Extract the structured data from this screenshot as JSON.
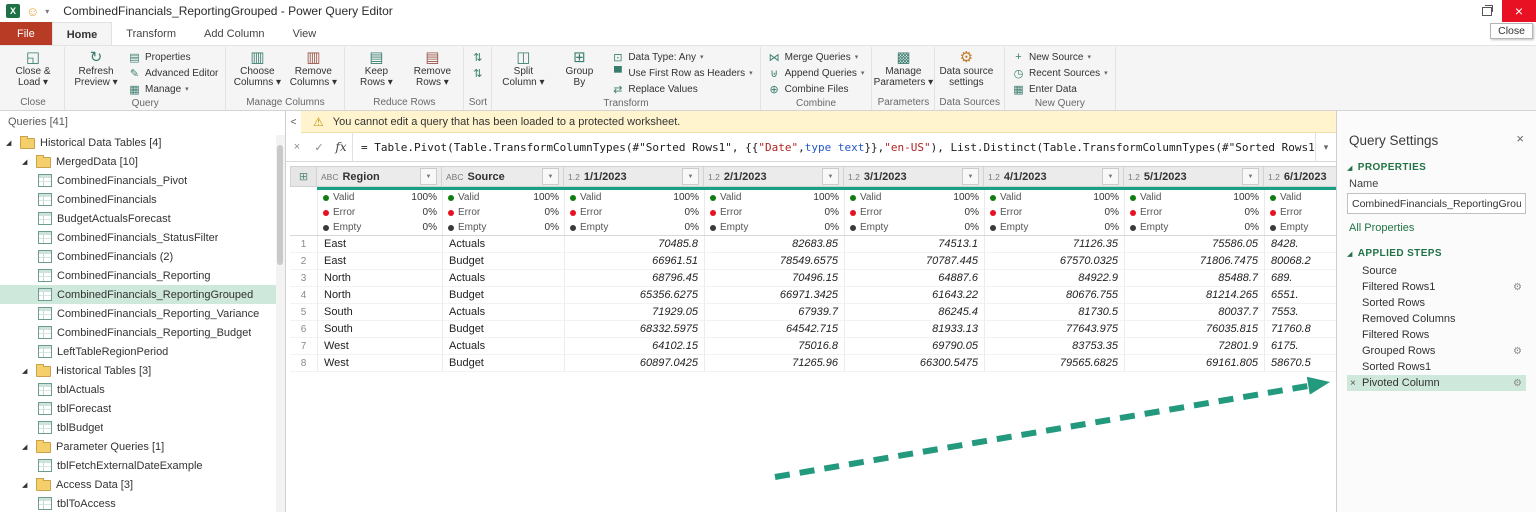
{
  "colors": {
    "accent_teal": "#18a084",
    "arrow_teal": "#23997d",
    "valid_green": "#107c10",
    "error_red": "#e81123",
    "empty_dark": "#3a3a38",
    "selected_green": "#cfe8dc",
    "file_tab_red": "#b83b26",
    "warning_bg": "#fff4ce",
    "section_green": "#217346"
  },
  "icons": {
    "excel-app": "X",
    "feedback-smiley": "☺",
    "qat-caret": "▾",
    "close-and-load": "◱",
    "refresh-preview": "↻",
    "properties": "▤",
    "advanced-editor": "✎",
    "manage-query": "▦",
    "choose-columns": "▥",
    "remove-columns": "▥",
    "keep-rows": "▤",
    "remove-rows": "▤",
    "sort-ascending": "⇅",
    "sort-descending": "⇅",
    "split-column": "◫",
    "group-by": "⊞",
    "data-type": "⊡",
    "use-first-row-as-headers": "▀",
    "replace-values": "⇄",
    "merge-queries": "⋈",
    "append-queries": "⊎",
    "combine-files": "⊕",
    "manage-parameters": "▩",
    "data-source-settings": "⚙",
    "new-source": "+",
    "recent-sources": "◷",
    "enter-data": "▦",
    "warning": "⚠",
    "corner": "⊞",
    "filter": "▼",
    "gear": "⚙",
    "delete": "×",
    "expander": "◢",
    "chevron-down": "▾",
    "collapse-left": "<",
    "cancel": "×",
    "check": "✓",
    "restore": "",
    "close": "×"
  },
  "titlebar": {
    "title": "CombinedFinancials_ReportingGrouped - Power Query Editor",
    "close_tooltip": "Close"
  },
  "ribbon": {
    "tabs": [
      {
        "label": "File",
        "style": "file"
      },
      {
        "label": "Home",
        "active": true
      },
      {
        "label": "Transform"
      },
      {
        "label": "Add Column"
      },
      {
        "label": "View"
      }
    ],
    "groups": [
      {
        "caption": "Close",
        "items": [
          {
            "kind": "big",
            "lines": [
              "Close &",
              "Load"
            ],
            "arrow": true,
            "icon": "close-and-load"
          }
        ]
      },
      {
        "caption": "Query",
        "items": [
          {
            "kind": "big",
            "lines": [
              "Refresh",
              "Preview"
            ],
            "arrow": true,
            "icon": "refresh-preview"
          },
          {
            "kind": "col",
            "buttons": [
              {
                "label": "Properties",
                "icon": "properties"
              },
              {
                "label": "Advanced Editor",
                "icon": "advanced-editor"
              },
              {
                "label": "Manage",
                "arrow": true,
                "icon": "manage-query"
              }
            ]
          }
        ]
      },
      {
        "caption": "Manage Columns",
        "items": [
          {
            "kind": "big",
            "lines": [
              "Choose",
              "Columns"
            ],
            "arrow": true,
            "icon": "choose-columns"
          },
          {
            "kind": "big",
            "lines": [
              "Remove",
              "Columns"
            ],
            "arrow": true,
            "icon": "remove-columns"
          }
        ]
      },
      {
        "caption": "Reduce Rows",
        "items": [
          {
            "kind": "big",
            "lines": [
              "Keep",
              "Rows"
            ],
            "arrow": true,
            "icon": "keep-rows"
          },
          {
            "kind": "big",
            "lines": [
              "Remove",
              "Rows"
            ],
            "arrow": true,
            "icon": "remove-rows"
          }
        ]
      },
      {
        "caption": "Sort",
        "items": [
          {
            "kind": "col",
            "buttons": [
              {
                "label": "",
                "icon": "sort-ascending"
              },
              {
                "label": "",
                "icon": "sort-descending"
              }
            ]
          }
        ]
      },
      {
        "caption": "Transform",
        "items": [
          {
            "kind": "big",
            "lines": [
              "Split",
              "Column"
            ],
            "arrow": true,
            "icon": "split-column"
          },
          {
            "kind": "big",
            "lines": [
              "Group",
              "By"
            ],
            "icon": "group-by"
          },
          {
            "kind": "col",
            "buttons": [
              {
                "label": "Data Type: Any",
                "arrow": true,
                "icon": "data-type"
              },
              {
                "label": "Use First Row as Headers",
                "arrow": true,
                "icon": "use-first-row-as-headers"
              },
              {
                "label": "Replace Values",
                "icon": "replace-values"
              }
            ]
          }
        ]
      },
      {
        "caption": "Combine",
        "items": [
          {
            "kind": "col",
            "buttons": [
              {
                "label": "Merge Queries",
                "arrow": true,
                "icon": "merge-queries"
              },
              {
                "label": "Append Queries",
                "arrow": true,
                "icon": "append-queries"
              },
              {
                "label": "Combine Files",
                "icon": "combine-files"
              }
            ]
          }
        ]
      },
      {
        "caption": "Parameters",
        "items": [
          {
            "kind": "big",
            "lines": [
              "Manage",
              "Parameters"
            ],
            "arrow": true,
            "icon": "manage-parameters"
          }
        ]
      },
      {
        "caption": "Data Sources",
        "items": [
          {
            "kind": "big",
            "lines": [
              "Data source",
              "settings"
            ],
            "icon": "data-source-settings"
          }
        ]
      },
      {
        "caption": "New Query",
        "items": [
          {
            "kind": "col",
            "buttons": [
              {
                "label": "New Source",
                "arrow": true,
                "icon": "new-source"
              },
              {
                "label": "Recent Sources",
                "arrow": true,
                "icon": "recent-sources"
              },
              {
                "label": "Enter Data",
                "icon": "enter-data"
              }
            ]
          }
        ]
      }
    ]
  },
  "sidebar": {
    "header": "Queries [41]",
    "collapse_icon": "<",
    "items": [
      {
        "label": "Historical Data Tables [4]",
        "type": "folder",
        "level": 0
      },
      {
        "label": "MergedData [10]",
        "type": "folder",
        "level": 1
      },
      {
        "label": "CombinedFinancials_Pivot",
        "type": "query",
        "level": 2
      },
      {
        "label": "CombinedFinancials",
        "type": "query",
        "level": 2
      },
      {
        "label": "BudgetActualsForecast",
        "type": "query",
        "level": 2
      },
      {
        "label": "CombinedFinancials_StatusFilter",
        "type": "query",
        "level": 2
      },
      {
        "label": "CombinedFinancials (2)",
        "type": "query",
        "level": 2
      },
      {
        "label": "CombinedFinancials_Reporting",
        "type": "query",
        "level": 2
      },
      {
        "label": "CombinedFinancials_ReportingGrouped",
        "type": "query",
        "level": 2,
        "selected": true
      },
      {
        "label": "CombinedFinancials_Reporting_Variance",
        "type": "query",
        "level": 2
      },
      {
        "label": "CombinedFinancials_Reporting_Budget",
        "type": "query",
        "level": 2
      },
      {
        "label": "LeftTableRegionPeriod",
        "type": "query",
        "level": 2
      },
      {
        "label": "Historical Tables [3]",
        "type": "folder",
        "level": 1
      },
      {
        "label": "tblActuals",
        "type": "query",
        "level": 2
      },
      {
        "label": "tblForecast",
        "type": "query",
        "level": 2
      },
      {
        "label": "tblBudget",
        "type": "query",
        "level": 2
      },
      {
        "label": "Parameter Queries [1]",
        "type": "folder",
        "level": 1
      },
      {
        "label": "tblFetchExternalDateExample",
        "type": "query",
        "level": 2
      },
      {
        "label": "Access Data [3]",
        "type": "folder",
        "level": 1
      },
      {
        "label": "tblToAccess",
        "type": "query",
        "level": 2
      }
    ]
  },
  "warning": {
    "text": "You cannot edit a query that has been loaded to a protected worksheet."
  },
  "formula": {
    "fx": "fx",
    "cancel": "×",
    "check": "✓",
    "chevron": "▾",
    "segments": [
      {
        "t": "= Table.Pivot(Table.TransformColumnTypes(#\"Sorted Rows1\", {{",
        "c": "plain"
      },
      {
        "t": "\"Date\"",
        "c": "string"
      },
      {
        "t": ", ",
        "c": "plain"
      },
      {
        "t": "type text",
        "c": "keyword"
      },
      {
        "t": "}}, ",
        "c": "plain"
      },
      {
        "t": "\"en-US\"",
        "c": "string"
      },
      {
        "t": "), List.Distinct(Table.TransformColumnTypes(#\"Sorted Rows1\", {{",
        "c": "plain"
      },
      {
        "t": "\"Date\"",
        "c": "string"
      },
      {
        "t": ", ",
        "c": "plain"
      },
      {
        "t": "type text",
        "c": "keyword"
      },
      {
        "t": "}}, ",
        "c": "plain"
      }
    ]
  },
  "grid": {
    "corner_icon": "⊞",
    "columns": [
      {
        "type": "ABC",
        "label": "Region",
        "width": 125
      },
      {
        "type": "ABC",
        "label": "Source",
        "width": 122
      },
      {
        "type": "1.2",
        "label": "1/1/2023",
        "width": 140,
        "numeric": true
      },
      {
        "type": "1.2",
        "label": "2/1/2023",
        "width": 140,
        "numeric": true
      },
      {
        "type": "1.2",
        "label": "3/1/2023",
        "width": 140,
        "numeric": true
      },
      {
        "type": "1.2",
        "label": "4/1/2023",
        "width": 140,
        "numeric": true
      },
      {
        "type": "1.2",
        "label": "5/1/2023",
        "width": 140,
        "numeric": true
      },
      {
        "type": "1.2",
        "label": "6/1/2023",
        "width": 140,
        "numeric": true,
        "clipped": true
      }
    ],
    "quality_labels": [
      "Valid",
      "Error",
      "Empty"
    ],
    "quality_values": [
      "100%",
      "0%",
      "0%"
    ],
    "rows": [
      {
        "n": "1",
        "cells": [
          "East",
          "Actuals",
          "70485.8",
          "82683.85",
          "74513.1",
          "71126.35",
          "75586.05",
          "8428."
        ]
      },
      {
        "n": "2",
        "cells": [
          "East",
          "Budget",
          "66961.51",
          "78549.6575",
          "70787.445",
          "67570.0325",
          "71806.7475",
          "80068.2"
        ]
      },
      {
        "n": "3",
        "cells": [
          "North",
          "Actuals",
          "68796.45",
          "70496.15",
          "64887.6",
          "84922.9",
          "85488.7",
          "689."
        ]
      },
      {
        "n": "4",
        "cells": [
          "North",
          "Budget",
          "65356.6275",
          "66971.3425",
          "61643.22",
          "80676.755",
          "81214.265",
          "6551."
        ]
      },
      {
        "n": "5",
        "cells": [
          "South",
          "Actuals",
          "71929.05",
          "67939.7",
          "86245.4",
          "81730.5",
          "80037.7",
          "7553."
        ]
      },
      {
        "n": "6",
        "cells": [
          "South",
          "Budget",
          "68332.5975",
          "64542.715",
          "81933.13",
          "77643.975",
          "76035.815",
          "71760.8"
        ]
      },
      {
        "n": "7",
        "cells": [
          "West",
          "Actuals",
          "64102.15",
          "75016.8",
          "69790.05",
          "83753.35",
          "72801.9",
          "6175."
        ]
      },
      {
        "n": "8",
        "cells": [
          "West",
          "Budget",
          "60897.0425",
          "71265.96",
          "66300.5475",
          "79565.6825",
          "69161.805",
          "58670.5"
        ]
      }
    ]
  },
  "settings": {
    "title": "Query Settings",
    "close_icon": "×",
    "properties_label": "PROPERTIES",
    "name_label": "Name",
    "name_value": "CombinedFinancials_ReportingGrouped",
    "all_properties": "All Properties",
    "applied_steps_label": "APPLIED STEPS",
    "steps": [
      {
        "label": "Source"
      },
      {
        "label": "Filtered Rows1",
        "gear": true
      },
      {
        "label": "Sorted Rows"
      },
      {
        "label": "Removed Columns"
      },
      {
        "label": "Filtered Rows"
      },
      {
        "label": "Grouped Rows",
        "gear": true
      },
      {
        "label": "Sorted Rows1"
      },
      {
        "label": "Pivoted Column",
        "gear": true,
        "selected": true
      }
    ]
  }
}
